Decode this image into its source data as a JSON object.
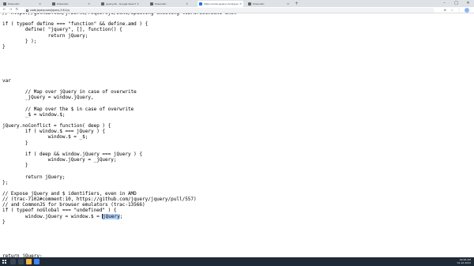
{
  "browser": {
    "tabs": [
      {
        "label": "Prisonatic"
      },
      {
        "label": "Prisonatic"
      },
      {
        "label": "jquery.db - Google Search"
      },
      {
        "label": "Prisonatic"
      },
      {
        "label": "https://code.jquery.com/jquery-3.6.0.js"
      },
      {
        "label": "Prisonatic"
      }
    ],
    "new_tab": "+",
    "window_controls": {
      "minimize": "–",
      "maximize": "□",
      "close": "✕"
    },
    "toolbar": {
      "back": "←",
      "forward": "→",
      "reload": "↻",
      "url": "code.jquery.com/jquery-3.6.0.js"
    }
  },
  "code": {
    "lines": [
      "// https://github.com/jrburke/requirejs/wiki/Updating-existing-libraries#wiki-anon",
      "",
      "if ( typeof define === \"function\" && define.amd ) {",
      "        define( \"jquery\", [], function() {",
      "                return jQuery;",
      "        } );",
      "}",
      "",
      "",
      "",
      "",
      "",
      "var",
      "",
      "        // Map over jQuery in case of overwrite",
      "        _jQuery = window.jQuery,",
      "",
      "        // Map over the $ in case of overwrite",
      "        _$ = window.$;",
      "",
      "jQuery.noConflict = function( deep ) {",
      "        if ( window.$ === jQuery ) {",
      "                window.$ = _$;",
      "        }",
      "",
      "        if ( deep && window.jQuery === jQuery ) {",
      "                window.jQuery = _jQuery;",
      "        }",
      "",
      "        return jQuery;",
      "};",
      "",
      "// Expose jQuery and $ identifiers, even in AMD",
      "// (trac-7102#comment:10, https://github.com/jquery/jquery/pull/557)",
      "// and CommonJS for browser emulators (trac-13566)",
      "if ( typeof noGlobal === \"undefined\" ) {",
      "        window.jQuery = window.$ = ",
      "}",
      "",
      "",
      "",
      "",
      "",
      "return jQuery;",
      "} );"
    ],
    "selected_word": "jQuery",
    "selected_suffix": ";"
  },
  "taskbar": {
    "time": "09:46 AM",
    "date": "01-10-2022"
  },
  "colors": {
    "selection": "#b4d5fe",
    "taskbar": "#202a36",
    "tab_strip": "#dee1e6"
  }
}
